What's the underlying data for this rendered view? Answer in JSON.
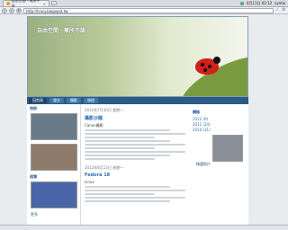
{
  "browser": {
    "tab_title": "自由空間・無所不談",
    "tab_close": "×",
    "url": "http://tracy.blogspot.tw",
    "clock": "4月11日 03:12",
    "user": "syntw"
  },
  "blog": {
    "title": "自由空間・無所不談",
    "nav": [
      "回首頁",
      "發文",
      "攝影",
      "旅遊"
    ],
    "left_heading_1": "快訊",
    "left_heading_2": "相簿",
    "left_link": "更多",
    "posts": [
      {
        "date": "2012年7月30日 星期一",
        "title": "攝影沙龍",
        "tag": "Canon攝影"
      },
      {
        "date": "2012年8月13日 星期一",
        "title": "Fedora 18",
        "tag": "Linux"
      }
    ],
    "right_heading": "網誌",
    "right_links": [
      "2012 (9)",
      "2011 (24)",
      "2010 (31)"
    ],
    "right_caption": "精選照片"
  }
}
